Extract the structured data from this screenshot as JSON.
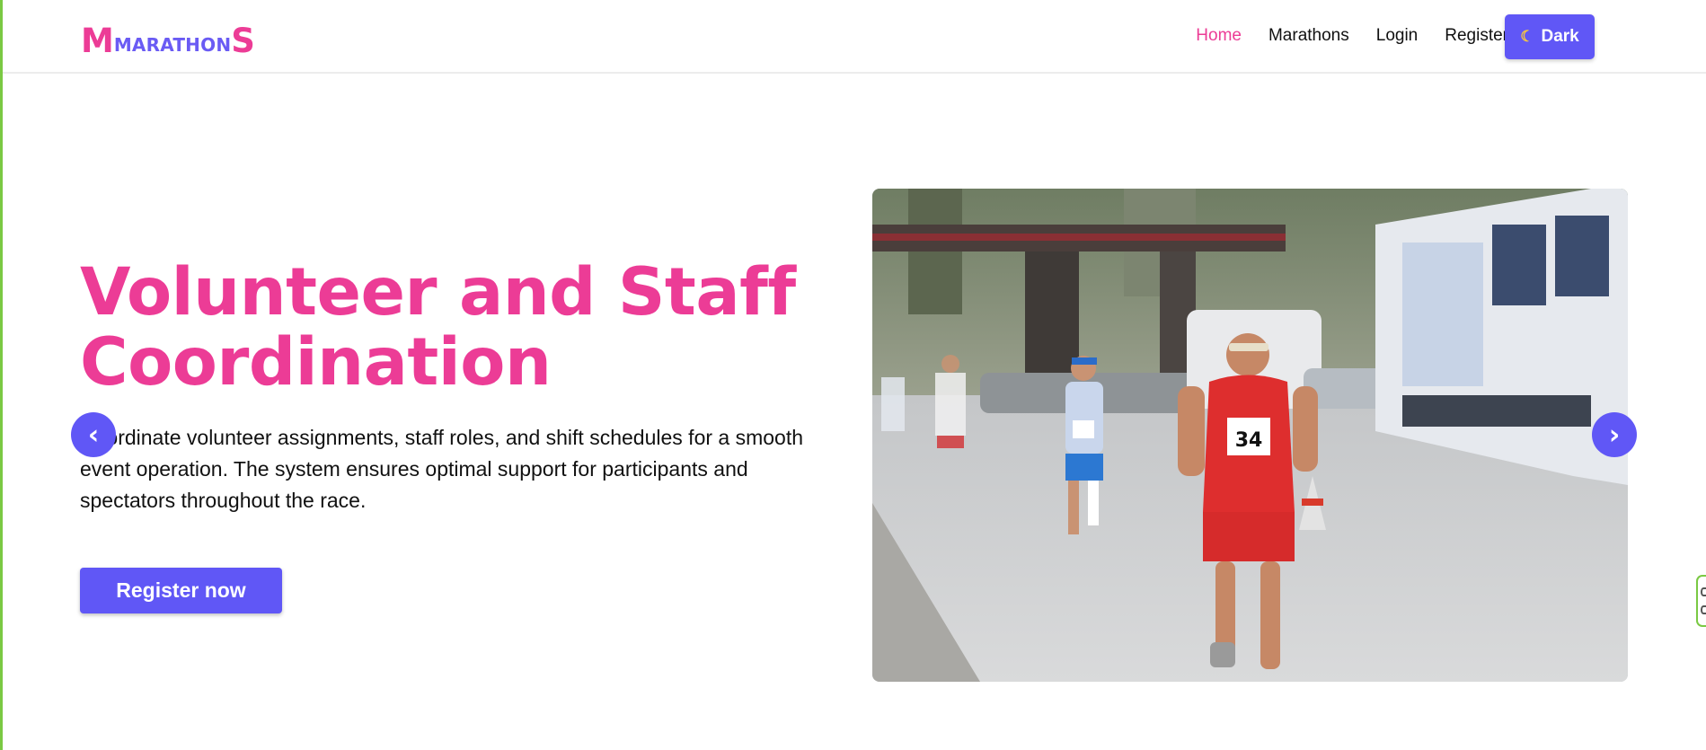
{
  "logo": {
    "first": "M",
    "middle": "MARATHON",
    "last": "S"
  },
  "nav": {
    "items": [
      {
        "label": "Home",
        "active": true
      },
      {
        "label": "Marathons",
        "active": false
      },
      {
        "label": "Login",
        "active": false
      },
      {
        "label": "Register",
        "active": false
      }
    ],
    "theme_toggle_label": "Dark",
    "theme_toggle_icon": "moon-icon"
  },
  "hero": {
    "title": "Volunteer and Staff Coordination",
    "description": "Coordinate volunteer assignments, staff roles, and shift schedules for a smooth event operation. The system ensures optimal support for participants and spectators throughout the race.",
    "cta_label": "Register now",
    "prev_icon": "chevron-left-icon",
    "next_icon": "chevron-right-icon",
    "prev_glyph": "‹",
    "next_glyph": "›",
    "runner_bib_number": "34"
  },
  "colors": {
    "accent_pink": "#ec3c96",
    "accent_purple": "#6057f6",
    "edge_green": "#7ac943"
  }
}
